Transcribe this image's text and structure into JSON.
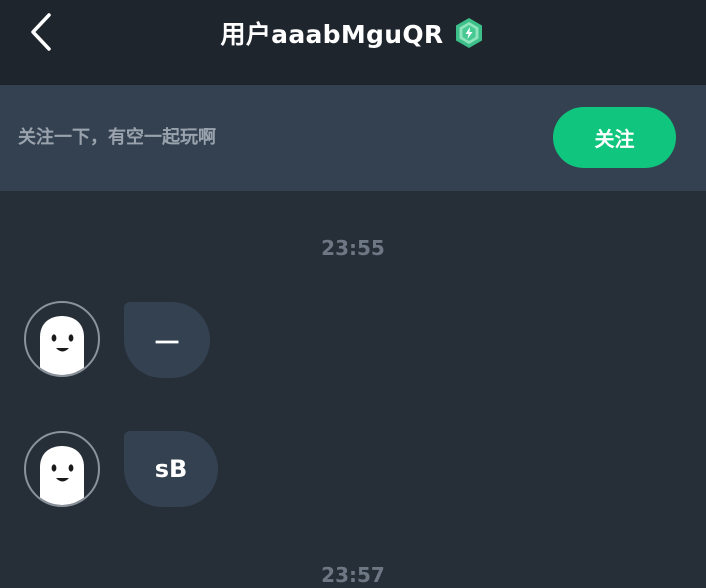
{
  "header": {
    "title": "用户aaabMguQR",
    "back_icon": "chevron-left-icon",
    "badge_icon": "hexagon-badge-icon"
  },
  "follow_banner": {
    "prompt": "关注一下，有空一起玩啊",
    "button_label": "关注"
  },
  "messages": [
    {
      "timestamp": "23:55"
    },
    {
      "text": "一",
      "avatar": "ghost-avatar"
    },
    {
      "text": "sB",
      "avatar": "ghost-avatar"
    },
    {
      "timestamp": "23:57"
    }
  ],
  "colors": {
    "background": "#262e38",
    "header": "#1e252d",
    "banner": "#334151",
    "bubble": "#334151",
    "accent": "#10c57d",
    "timestamp": "#6d7884",
    "prompt_text": "#9aa3ad"
  }
}
